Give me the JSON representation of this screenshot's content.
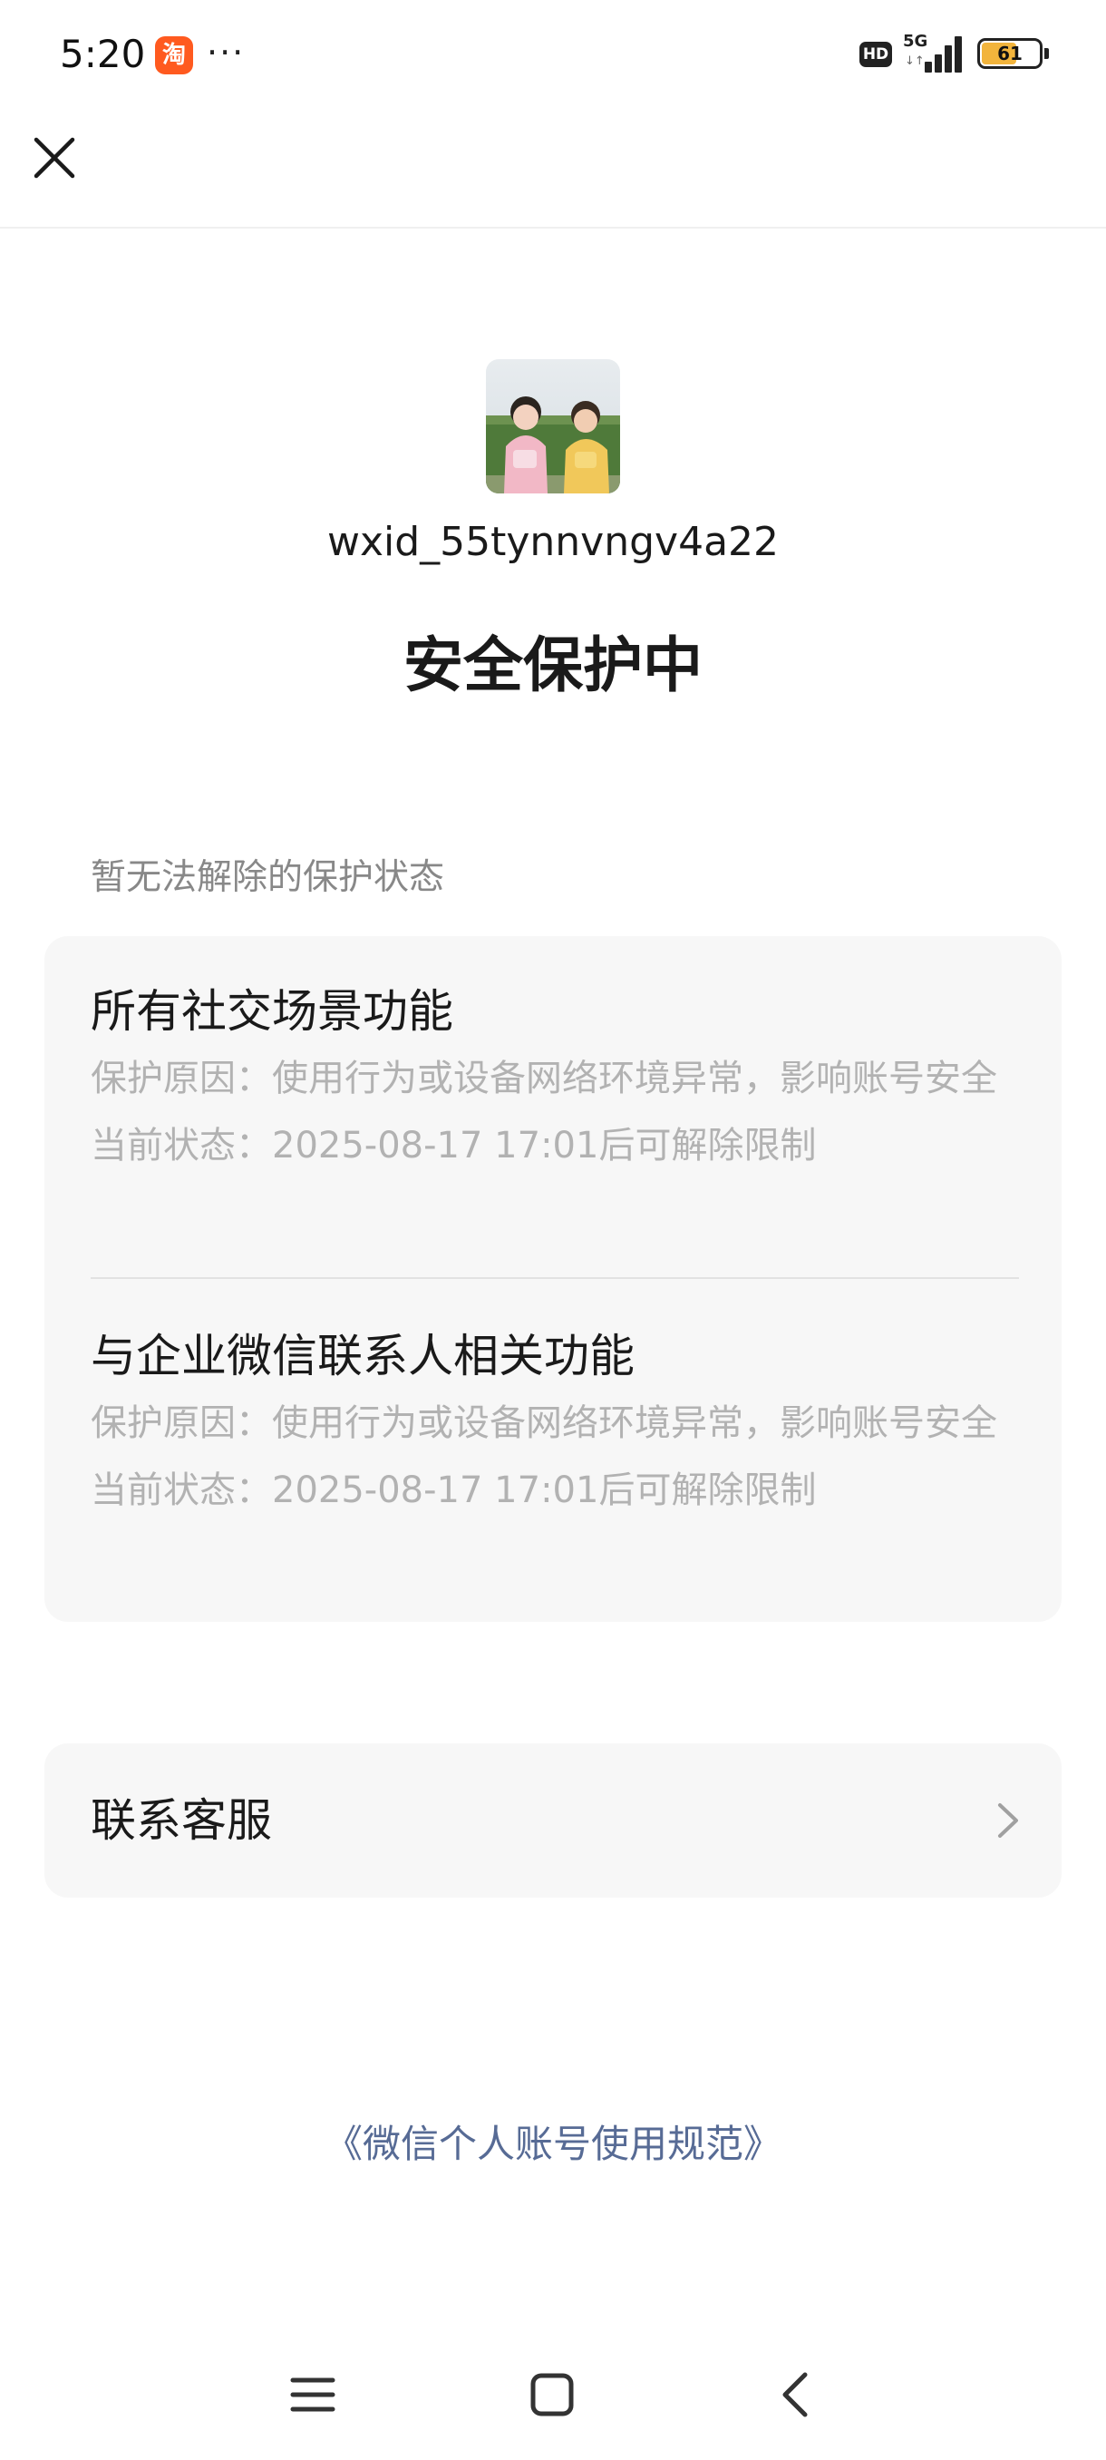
{
  "status_bar": {
    "time": "5:20",
    "notification_icon": "taobao-app-icon",
    "notification_glyph": "淘",
    "more_dots": "···",
    "hd": "HD",
    "network": "5G",
    "network_arrows": "↓↑",
    "battery_level": "61",
    "battery_fraction": 0.61,
    "battery_color": "#f2b43c"
  },
  "nav": {
    "close_icon": "close-icon"
  },
  "profile": {
    "avatar_icon": "user-avatar-photo",
    "wxid": "wxid_55tynnvngv4a22"
  },
  "title": "安全保护中",
  "restrictions": {
    "section_label": "暂无法解除的保护状态",
    "items": [
      {
        "title": "所有社交场景功能",
        "reason": "保护原因：使用行为或设备网络环境异常，影响账号安全",
        "status": "当前状态：2025-08-17 17:01后可解除限制"
      },
      {
        "title": "与企业微信联系人相关功能",
        "reason": "保护原因：使用行为或设备网络环境异常，影响账号安全",
        "status": "当前状态：2025-08-17 17:01后可解除限制"
      }
    ]
  },
  "contact": {
    "label": "联系客服",
    "chevron_icon": "chevron-right-icon"
  },
  "policy_link": "《微信个人账号使用规范》",
  "colors": {
    "link": "#576b95",
    "secondary_text": "#b2b2b2",
    "section_label": "#888888",
    "card_bg": "#f7f7f7"
  },
  "system_nav": {
    "menu_icon": "menu-icon",
    "home_icon": "home-icon",
    "back_icon": "back-icon"
  }
}
